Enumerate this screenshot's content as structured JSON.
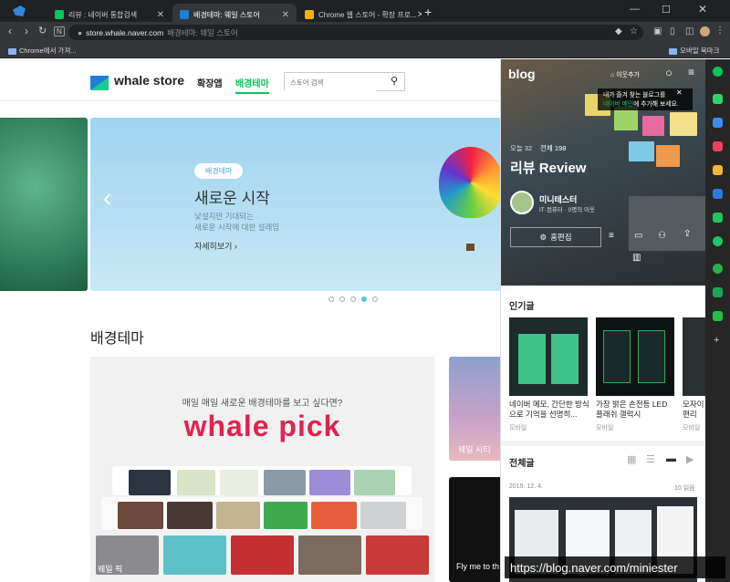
{
  "tabs": [
    {
      "label": "리뷰 : 네이버 통합검색",
      "active": false,
      "color": "#03c75a"
    },
    {
      "label": "배경테마: 웨일 스토어",
      "active": true,
      "color": "#1e7ed8"
    },
    {
      "label": "Chrome 웹 스토어 - 확장 프로...",
      "active": false,
      "color": "#f4b400"
    }
  ],
  "omnibox": {
    "url": "store.whale.naver.com",
    "hint": "배경테마: 웨일 스토어"
  },
  "bookmarks": {
    "left": "Chrome에서 가져...",
    "right": "모바일 북마크"
  },
  "store": {
    "brand": "whale store",
    "nav_extensions": "확장앱",
    "nav_themes": "배경테마",
    "search_placeholder": "스토어 검색"
  },
  "hero": {
    "badge": "배경테마",
    "title": "새로운 시작",
    "desc1": "낯설지만 기대되는",
    "desc2": "새로운 시작에 대한 설레임",
    "more": "자세히보기"
  },
  "section_title": "배경테마",
  "pick": {
    "subtitle": "매일 매일 새로운 배경테마를 보고 싶다면?",
    "title": "whale pick",
    "label": "웨일 픽"
  },
  "side_cards": [
    "웨일 시티",
    "Fly me to th"
  ],
  "blog": {
    "logo": "blog",
    "add_neighbor": "이웃추가",
    "tooltip1": "내가 즐겨 찾는 블로그를",
    "tooltip_link": "네이버 메인",
    "tooltip2": "에 추가해 보세요.",
    "stats_today": "오늘 32",
    "stats_total": "전체 198",
    "title": "리뷰 Review",
    "owner": "미니테스터",
    "owner_meta": "IT·컴퓨터 · 0명의 이웃",
    "edit_home": "홈편집",
    "popular_heading": "인기글",
    "popular": [
      {
        "title": "네이버 메모, 간단한 방식으로 기억을 선명히...",
        "category": "모바일"
      },
      {
        "title": "가장 밝은 손전등 LED 플래쉬 갤럭시",
        "category": "모바일"
      },
      {
        "title": "모자이 단/편리",
        "category": "모바일"
      }
    ],
    "all_heading": "전체글",
    "post_date": "2019. 12. 4.",
    "post_reads": "10 읽음"
  },
  "status_url": "https://blog.naver.com/miniester",
  "colors": {
    "accent": "#03c75a",
    "pick_red": "#e0234e",
    "whale_blue": "#1e7ed8"
  }
}
